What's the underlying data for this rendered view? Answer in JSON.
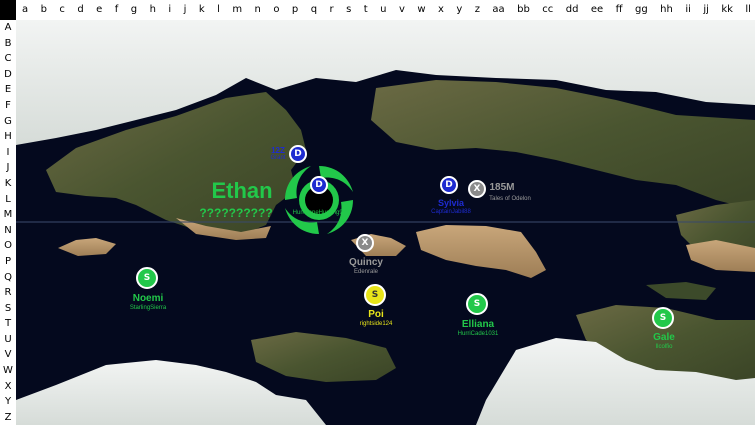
{
  "columns": [
    "a",
    "b",
    "c",
    "d",
    "e",
    "f",
    "g",
    "h",
    "i",
    "j",
    "k",
    "l",
    "m",
    "n",
    "o",
    "p",
    "q",
    "r",
    "s",
    "t",
    "u",
    "v",
    "w",
    "x",
    "y",
    "z",
    "aa",
    "bb",
    "cc",
    "dd",
    "ee",
    "ff",
    "gg",
    "hh",
    "ii",
    "jj",
    "kk",
    "ll"
  ],
  "rows": [
    "A",
    "B",
    "C",
    "D",
    "E",
    "F",
    "G",
    "H",
    "I",
    "J",
    "K",
    "L",
    "M",
    "N",
    "O",
    "P",
    "Q",
    "R",
    "S",
    "T",
    "U",
    "V",
    "W",
    "X",
    "Y",
    "Z"
  ],
  "colors": {
    "green": "#22c84a",
    "navy": "#1e2bd0",
    "gray": "#8a8a8a",
    "yellow": "#e8e41a",
    "ocean": "#04091e"
  },
  "storms": {
    "ethan": {
      "name": "Ethan",
      "sub": "??????????",
      "user": "HurricaneHunting999",
      "icon": "hurricane-icon"
    },
    "ethan_marker": {
      "symbol": "D"
    },
    "blue_storm_nw": {
      "name": "12Z",
      "user": "Grant",
      "symbol": "D"
    },
    "sylvia": {
      "name": "Sylvia",
      "user": "CaptainJabil88",
      "symbol": "D"
    },
    "storm_185m": {
      "name": "185M",
      "user": "Tales of Odelon",
      "symbol": "X"
    },
    "quincy": {
      "name": "Quincy",
      "user": "Edenrale",
      "symbol": "X"
    },
    "noemi": {
      "name": "Noemi",
      "user": "StarlingSierra",
      "symbol": "S"
    },
    "poi": {
      "name": "Poi",
      "user": "rightside124",
      "symbol": "S"
    },
    "elliana": {
      "name": "Elliana",
      "user": "HurriCade1031",
      "symbol": "S"
    },
    "gale": {
      "name": "Gale",
      "user": "Ilcolfio",
      "symbol": "S"
    }
  }
}
